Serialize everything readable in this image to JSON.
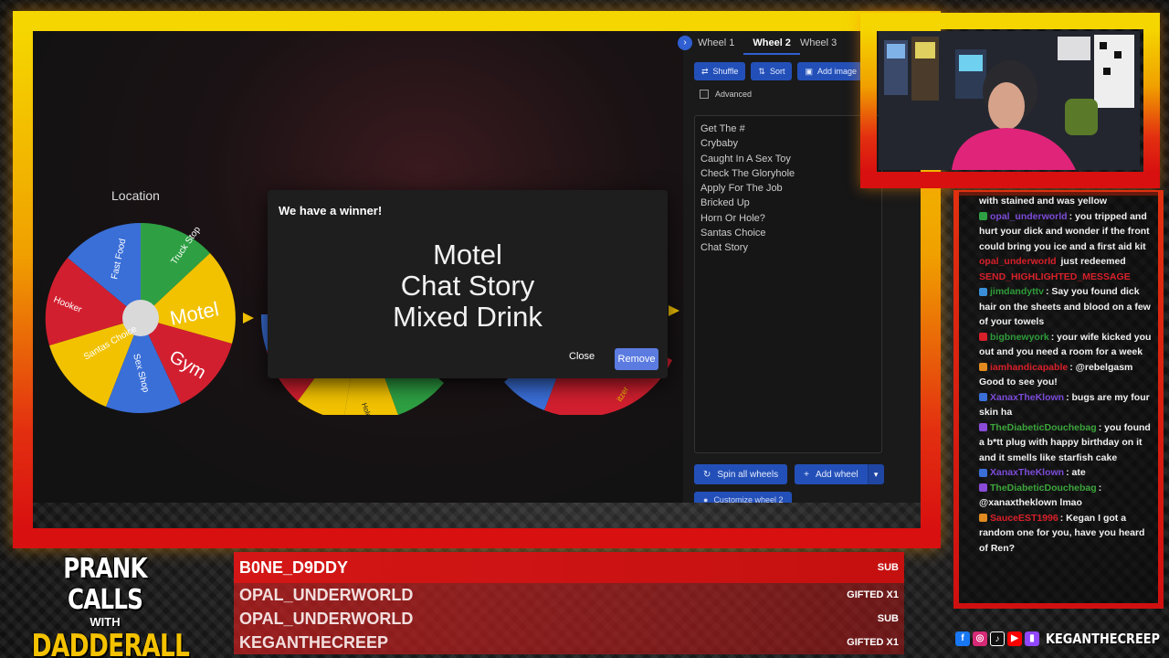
{
  "app": {
    "wheel_label": "Location",
    "wheel_segments": [
      {
        "label": "Truck Stop",
        "color": "#2ea043"
      },
      {
        "label": "Motel",
        "color": "#f2c200"
      },
      {
        "label": "Gym",
        "color": "#d21f2f"
      },
      {
        "label": "Sex Shop",
        "color": "#3a6fd8"
      },
      {
        "label": "Santas Choice",
        "color": "#f2c200"
      },
      {
        "label": "Hooker",
        "color": "#d21f2f"
      },
      {
        "label": "Fast Food",
        "color": "#3a6fd8"
      }
    ],
    "second_wheel_segment": "Hole?",
    "third_wheel_segment": "itzer"
  },
  "panel": {
    "tabs": [
      {
        "label": "Wheel 1"
      },
      {
        "label": "Wheel 2",
        "active": true
      },
      {
        "label": "Wheel 3"
      }
    ],
    "toolbar": {
      "shuffle": "Shuffle",
      "sort": "Sort",
      "add_image": "Add image"
    },
    "advanced_label": "Advanced",
    "entries": [
      "Get The #",
      "Crybaby",
      "Caught In A Sex Toy",
      "Check The Gloryhole",
      "Apply For The Job",
      "Bricked Up",
      "Horn Or Hole?",
      "Santas Choice",
      "Chat Story"
    ],
    "spin_all": "Spin all wheels",
    "add_wheel": "Add wheel",
    "customize": "Customize wheel 2"
  },
  "modal": {
    "title": "We have a winner!",
    "results": [
      "Motel",
      "Chat Story",
      "Mixed Drink"
    ],
    "close_label": "Close",
    "remove_label": "Remove"
  },
  "chat": {
    "lines": [
      {
        "user": "",
        "text": "with stained and was yellow",
        "user_color": "#ffffff"
      },
      {
        "user": "opal_underworld",
        "text": ": you tripped and hurt your dick and wonder if the front could bring you ice and a first aid kit",
        "user_color": "#7b4bd8"
      },
      {
        "user": "opal_underworld",
        "text": " just redeemed",
        "user_color": "#d8202a"
      },
      {
        "user": "",
        "text": "SEND_HIGHLIGHTED_MESSAGE",
        "user_color": "#d8202a"
      },
      {
        "user": "jimdandyttv",
        "text": ": Say you found dick hair on the sheets and blood on a few of your towels",
        "user_color": "#2e9b3a"
      },
      {
        "user": "bigbnewyork",
        "text": ": your wife kicked you out and you need a room for a week",
        "user_color": "#2e9b3a"
      },
      {
        "user": "iamhandicapable",
        "text": ": @rebelgasm Good to see you!",
        "user_color": "#d8202a"
      },
      {
        "user": "XanaxTheKlown",
        "text": ": bugs are my four skin ha",
        "user_color": "#7b4bd8"
      },
      {
        "user": "TheDiabeticDouchebag",
        "text": ": you found a b*tt plug with happy birthday on it and it smells like starfish cake",
        "user_color": "#3ca63c"
      },
      {
        "user": "XanaxTheKlown",
        "text": ": ate",
        "user_color": "#7b4bd8"
      },
      {
        "user": "TheDiabeticDouchebag",
        "text": ": @xanaxtheklown lmao",
        "user_color": "#3ca63c"
      },
      {
        "user": "SauceEST1996",
        "text": ": Kegan I got a random one for you, have you heard of Ren?",
        "user_color": "#d8202a"
      }
    ]
  },
  "logo": {
    "top": "PRANK CALLS",
    "with": "WITH",
    "bottom": "DADDERALL"
  },
  "events": [
    {
      "name": "B0NE_D9DDY",
      "tag": "SUB"
    },
    {
      "name": "OPAL_UNDERWORLD",
      "tag": "GIFTED X1"
    },
    {
      "name": "OPAL_UNDERWORLD",
      "tag": "SUB"
    },
    {
      "name": "KEGANTHECREEP",
      "tag": "GIFTED X1"
    }
  ],
  "socials": {
    "handle": "KEGANTHECREEP"
  }
}
